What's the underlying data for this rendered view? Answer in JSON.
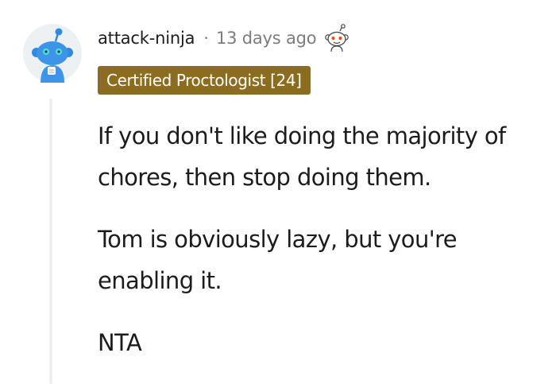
{
  "comment": {
    "author": "attack-ninja",
    "separator": "·",
    "timestamp": "13 days ago",
    "flair": "Certified Proctologist [24]",
    "paragraphs": [
      "If you don't like doing the majority of chores, then stop doing them.",
      "Tom is obviously lazy, but you're enabling it.",
      "NTA"
    ],
    "avatar_icon": "snoo-avatar-icon",
    "award_icon": "snoo-award-icon"
  },
  "colors": {
    "flair_bg": "#8c6d1f",
    "avatar_blue": "#2f8ae0",
    "meta_text": "#7c7c7c",
    "thread_line": "#edeff1"
  }
}
